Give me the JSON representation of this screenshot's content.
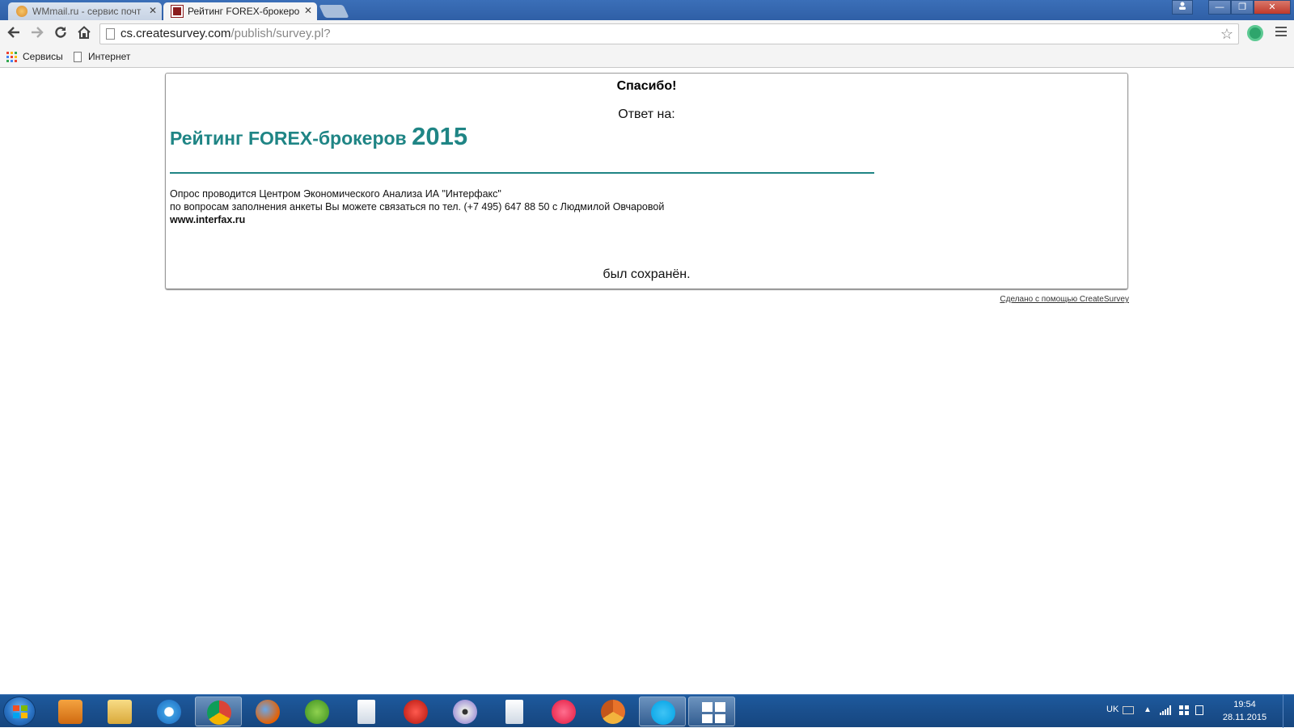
{
  "browser": {
    "tabs": [
      {
        "title": "WMmail.ru - сервис почт",
        "active": false,
        "favicon": "wmmail-icon"
      },
      {
        "title": "Рейтинг FOREX-брокеро",
        "active": true,
        "favicon": "createsurvey-icon"
      }
    ],
    "close_glyph": "✕",
    "window_buttons": {
      "minimize": "—",
      "maximize": "❐",
      "close": "✕"
    },
    "url_host": "cs.createsurvey.com",
    "url_path": "/publish/survey.pl?",
    "bookmarks": [
      {
        "label": "Сервисы",
        "icon": "apps-icon"
      },
      {
        "label": "Интернет",
        "icon": "page-icon"
      }
    ]
  },
  "page": {
    "thanks": "Спасибо!",
    "answer_on": "Ответ на:",
    "survey_title": "Рейтинг FOREX-брокеров",
    "survey_year": "2015",
    "info_line1": "Опрос проводится Центром Экономического Анализа ИА \"Интерфакс\"",
    "info_line2": "по вопросам заполнения анкеты Вы можете связаться по тел. (+7 495) 647 88 50 с Людмилой Овчаровой",
    "info_link": "www.interfax.ru",
    "saved": "был сохранён.",
    "made_with": "Сделано с помощью CreateSurvey",
    "accent_color": "#1f8585"
  },
  "taskbar": {
    "icons": [
      "media-player-icon",
      "file-explorer-icon",
      "internet-explorer-icon",
      "chrome-icon",
      "firefox-icon",
      "utorrent-icon",
      "notepad-icon",
      "pokerstars-icon",
      "dvd-icon",
      "notepad-icon",
      "itunes-icon",
      "chrome-canary-icon",
      "skype-icon",
      "windows-icon"
    ],
    "language": "UK",
    "time": "19:54",
    "date": "28.11.2015"
  }
}
